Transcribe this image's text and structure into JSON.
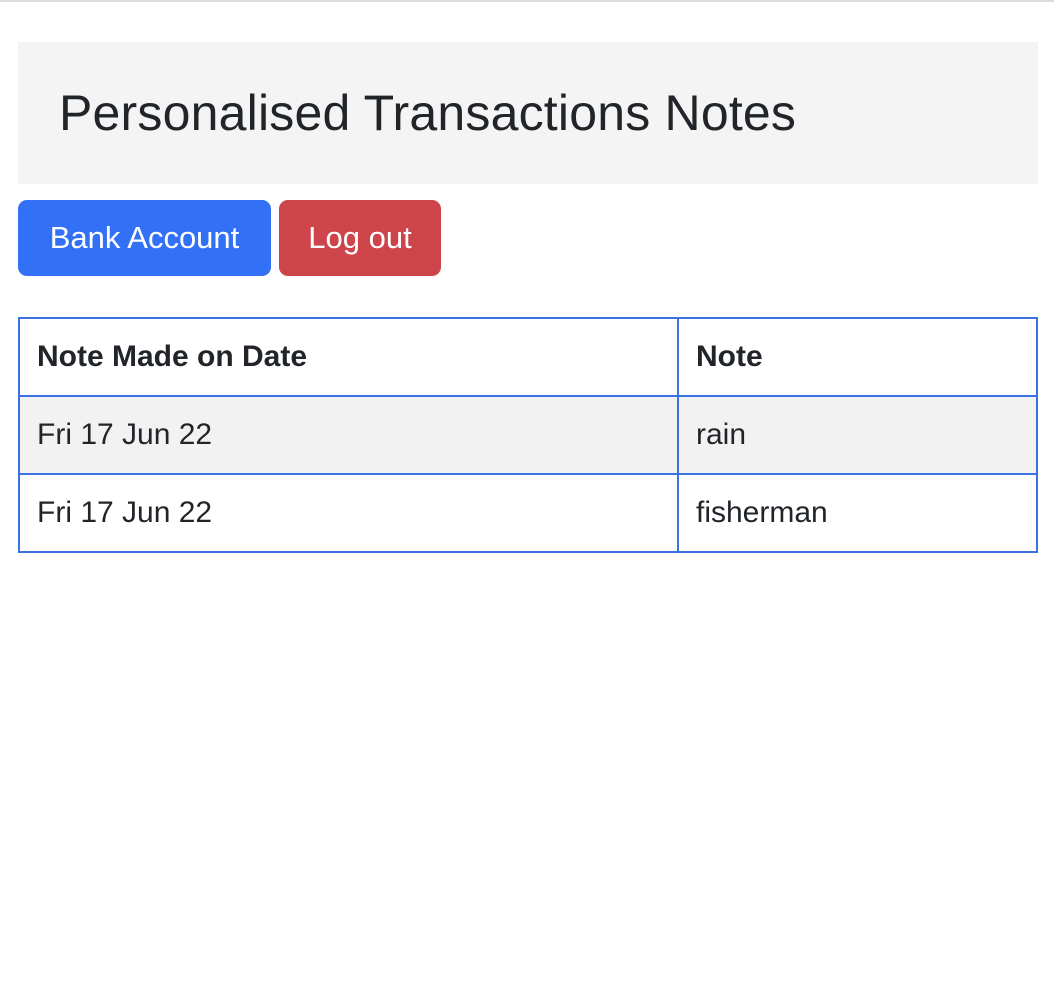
{
  "header": {
    "title": "Personalised Transactions Notes"
  },
  "buttons": {
    "bank_account_label": "Bank Account",
    "logout_label": "Log out"
  },
  "table": {
    "columns": [
      "Note Made on Date",
      "Note"
    ],
    "rows": [
      {
        "date": "Fri 17 Jun 22",
        "note": "rain"
      },
      {
        "date": "Fri 17 Jun 22",
        "note": "fisherman"
      }
    ]
  },
  "colors": {
    "primary": "#3271f5",
    "danger": "#cd444b",
    "table_border": "#3a73e0",
    "header_bg": "#f4f4f4"
  }
}
